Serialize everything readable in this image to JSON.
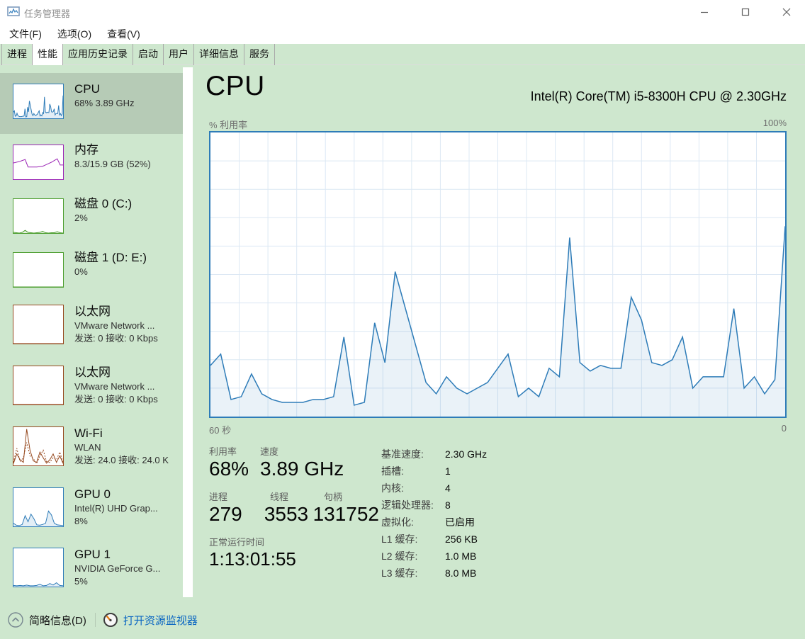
{
  "window": {
    "title": "任务管理器"
  },
  "menu": {
    "items": [
      "文件(F)",
      "选项(O)",
      "查看(V)"
    ]
  },
  "tabs": [
    {
      "label": "进程",
      "active": false
    },
    {
      "label": "性能",
      "active": true
    },
    {
      "label": "应用历史记录",
      "active": false
    },
    {
      "label": "启动",
      "active": false
    },
    {
      "label": "用户",
      "active": false
    },
    {
      "label": "详细信息",
      "active": false
    },
    {
      "label": "服务",
      "active": false
    }
  ],
  "sidebar": {
    "items": [
      {
        "title": "CPU",
        "lines": [
          "68% 3.89 GHz"
        ],
        "color": "#2e7cb8",
        "selected": true
      },
      {
        "title": "内存",
        "lines": [
          "8.3/15.9 GB (52%)"
        ],
        "color": "#9b26b5"
      },
      {
        "title": "磁盘 0 (C:)",
        "lines": [
          "2%"
        ],
        "color": "#4d9e2f"
      },
      {
        "title": "磁盘 1 (D: E:)",
        "lines": [
          "0%"
        ],
        "color": "#4d9e2f"
      },
      {
        "title": "以太网",
        "lines": [
          "VMware Network ...",
          "发送: 0 接收: 0 Kbps"
        ],
        "color": "#96491f"
      },
      {
        "title": "以太网",
        "lines": [
          "VMware Network ...",
          "发送: 0 接收: 0 Kbps"
        ],
        "color": "#96491f"
      },
      {
        "title": "Wi-Fi",
        "lines": [
          "WLAN",
          "发送: 24.0 接收: 24.0 K"
        ],
        "color": "#96491f"
      },
      {
        "title": "GPU 0",
        "lines": [
          "Intel(R) UHD Grap...",
          "8%"
        ],
        "color": "#2e7cb8"
      },
      {
        "title": "GPU 1",
        "lines": [
          "NVIDIA GeForce G...",
          "5%"
        ],
        "color": "#2e7cb8"
      }
    ]
  },
  "main": {
    "title": "CPU",
    "subtitle": "Intel(R) Core(TM) i5-8300H CPU @ 2.30GHz",
    "axis_top_left": "% 利用率",
    "axis_top_right": "100%",
    "axis_bottom_left": "60 秒",
    "axis_bottom_right": "0",
    "stats_row1": [
      {
        "label": "利用率",
        "value": "68%"
      },
      {
        "label": "速度",
        "value": "3.89 GHz"
      }
    ],
    "stats_row2": [
      {
        "label": "进程",
        "value": "279"
      },
      {
        "label": "线程",
        "value": "3553"
      },
      {
        "label": "句柄",
        "value": "131752"
      }
    ],
    "uptime": {
      "label": "正常运行时间",
      "value": "1:13:01:55"
    },
    "stats_right": [
      {
        "label": "基准速度:",
        "value": "2.30 GHz"
      },
      {
        "label": "插槽:",
        "value": "1"
      },
      {
        "label": "内核:",
        "value": "4"
      },
      {
        "label": "逻辑处理器:",
        "value": "8"
      },
      {
        "label": "虚拟化:",
        "value": "已启用"
      },
      {
        "label": "L1 缓存:",
        "value": "256 KB"
      },
      {
        "label": "L2 缓存:",
        "value": "1.0 MB"
      },
      {
        "label": "L3 缓存:",
        "value": "8.0 MB"
      }
    ]
  },
  "footer": {
    "collapse_label": "简略信息(D)",
    "resmon_label": "打开资源监视器",
    "link_color": "#0a66c2"
  },
  "chart_data": {
    "type": "area",
    "title": "CPU % 利用率 (60 秒窗口)",
    "xlabel": "秒",
    "ylabel": "% 利用率",
    "x_range_seconds": [
      60,
      0
    ],
    "ylim": [
      0,
      100
    ],
    "grid": {
      "cols": 20,
      "rows": 10,
      "color": "#dce8f4"
    },
    "line_color": "#2e7cb8",
    "fill_color": "rgba(46,124,184,0.10)",
    "series": [
      {
        "name": "CPU 利用率 %",
        "values": [
          18,
          22,
          6,
          7,
          15,
          8,
          6,
          5,
          5,
          5,
          6,
          6,
          7,
          28,
          4,
          5,
          33,
          19,
          51,
          38,
          25,
          12,
          8,
          14,
          10,
          8,
          10,
          12,
          17,
          22,
          7,
          10,
          7,
          17,
          14,
          63,
          19,
          16,
          18,
          17,
          17,
          42,
          34,
          19,
          18,
          20,
          28,
          10,
          14,
          14,
          14,
          38,
          10,
          14,
          8,
          13,
          67
        ]
      }
    ],
    "current_value_pct": 68,
    "sparklines": {
      "memory": [
        48,
        50,
        52,
        55,
        58,
        36,
        36,
        36,
        36,
        37,
        38,
        42,
        46,
        50,
        55,
        60,
        42,
        42
      ],
      "disk0": [
        2,
        1,
        0,
        2,
        8,
        2,
        1,
        0,
        1,
        2,
        5,
        1,
        0,
        1,
        1,
        4,
        1,
        0
      ],
      "disk1": [
        0,
        0,
        0,
        0,
        0,
        0
      ],
      "flat": [
        0,
        0,
        0,
        0
      ],
      "wifi_recv": [
        5,
        30,
        15,
        8,
        95,
        40,
        12,
        8,
        35,
        20,
        6,
        15,
        30,
        8,
        25,
        5
      ],
      "wifi_send": [
        8,
        45,
        10,
        20,
        60,
        25,
        18,
        5,
        25,
        40,
        10,
        8,
        20,
        15,
        35,
        8
      ],
      "gpu0": [
        8,
        3,
        2,
        5,
        28,
        12,
        32,
        20,
        4,
        3,
        5,
        8,
        40,
        30,
        8,
        4,
        3,
        2
      ],
      "gpu1": [
        3,
        2,
        3,
        2,
        4,
        2,
        2,
        3,
        6,
        2,
        3,
        8,
        4,
        10,
        3,
        2
      ]
    }
  }
}
